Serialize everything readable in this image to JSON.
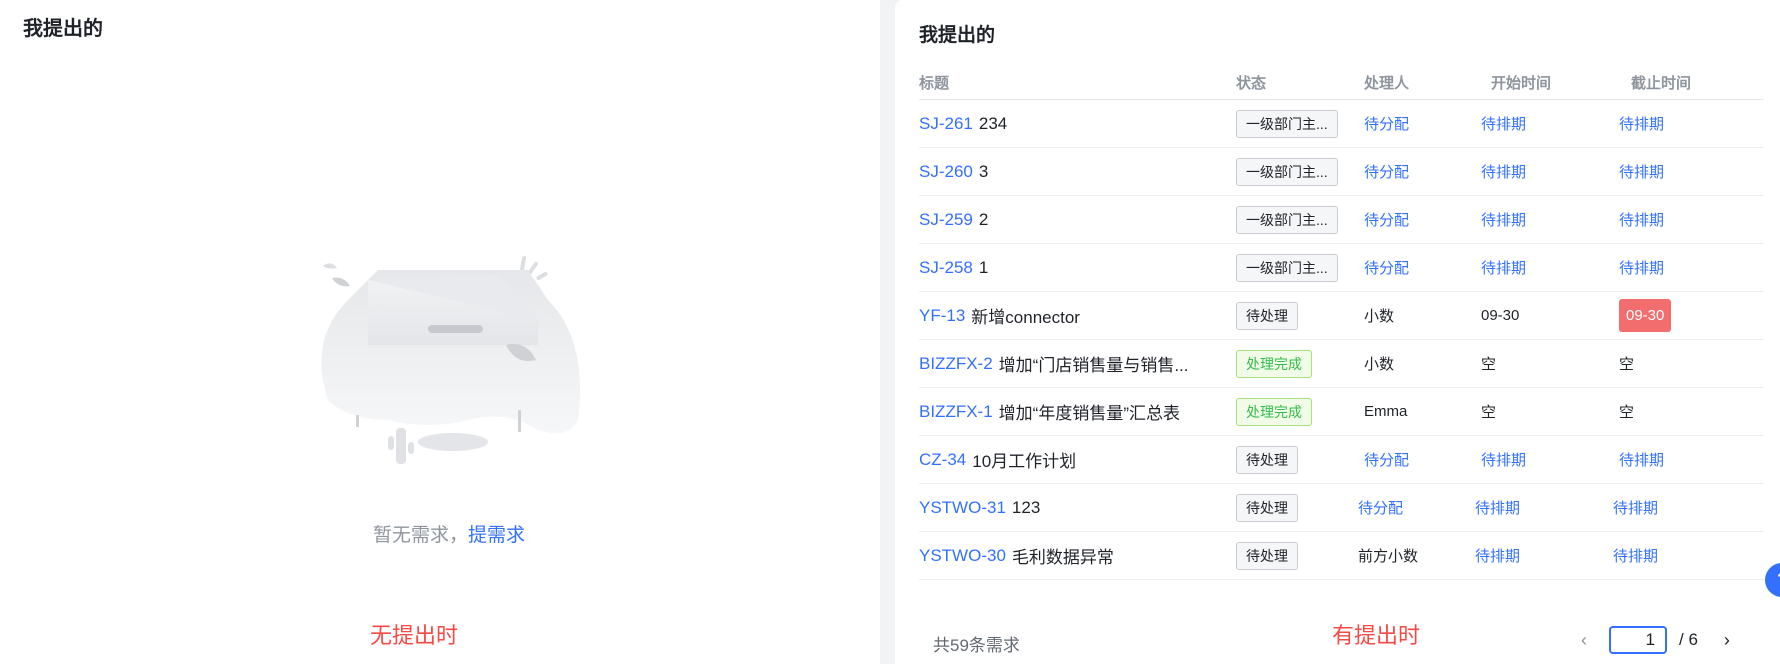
{
  "left": {
    "title": "我提出的",
    "empty_text": "暂无需求，",
    "empty_link": "提需求",
    "caption": "无提出时"
  },
  "right": {
    "title": "我提出的",
    "columns": [
      "标题",
      "状态",
      "处理人",
      "开始时间",
      "截止时间"
    ],
    "rows": [
      {
        "key": "SJ-261",
        "name": "234",
        "status": "一级部门主...",
        "status_type": "default",
        "handler": "待分配",
        "start": "待排期",
        "end": "待排期"
      },
      {
        "key": "SJ-260",
        "name": "3",
        "status": "一级部门主...",
        "status_type": "default",
        "handler": "待分配",
        "start": "待排期",
        "end": "待排期"
      },
      {
        "key": "SJ-259",
        "name": "2",
        "status": "一级部门主...",
        "status_type": "default",
        "handler": "待分配",
        "start": "待排期",
        "end": "待排期"
      },
      {
        "key": "SJ-258",
        "name": "1",
        "status": "一级部门主...",
        "status_type": "default",
        "handler": "待分配",
        "start": "待排期",
        "end": "待排期"
      },
      {
        "key": "YF-13",
        "name": "新增connector",
        "status": "待处理",
        "status_type": "default",
        "handler": "小数",
        "start": "09-30",
        "end": "09-30",
        "end_overdue": true
      },
      {
        "key": "BIZZFX-2",
        "name": "增加“门店销售量与销售...",
        "status": "处理完成",
        "status_type": "done",
        "handler": "小数",
        "start": "空",
        "end": "空"
      },
      {
        "key": "BIZZFX-1",
        "name": "增加“年度销售量”汇总表",
        "status": "处理完成",
        "status_type": "done",
        "handler": "Emma",
        "start": "空",
        "end": "空"
      },
      {
        "key": "CZ-34",
        "name": "10月工作计划",
        "status": "待处理",
        "status_type": "default",
        "handler": "待分配",
        "start": "待排期",
        "end": "待排期"
      },
      {
        "key": "YSTWO-31",
        "name": "123",
        "status": "待处理",
        "status_type": "default",
        "handler": "待分配",
        "start": "待排期",
        "end": "待排期"
      },
      {
        "key": "YSTWO-30",
        "name": "毛利数据异常",
        "status": "待处理",
        "status_type": "default",
        "handler": "前方小数",
        "start": "待排期",
        "end": "待排期"
      }
    ],
    "total_text": "共59条需求",
    "caption": "有提出时",
    "pager": {
      "current": "1",
      "total": "/ 6",
      "prev_icon": "‹",
      "next_icon": "›"
    },
    "help_icon": "?"
  }
}
